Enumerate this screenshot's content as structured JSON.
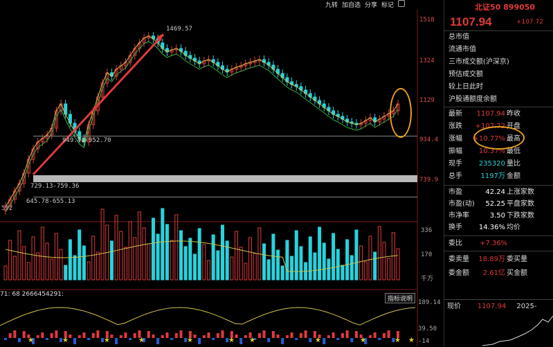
{
  "toolbar": {
    "items": [
      "九转",
      "加自选",
      "分享",
      "标记"
    ]
  },
  "price_axis": [
    "1518",
    "1324",
    "1129",
    "934.4",
    "739.9",
    "592"
  ],
  "volume_axis": [
    "336",
    "170",
    "千万"
  ],
  "indicator_axis": [
    "189.14",
    "39.50",
    "-14"
  ],
  "annotations": {
    "peak": "1469.57",
    "level1": "949.41-952.70",
    "level2": "729.13-759.36",
    "level3": "645.78-655.13"
  },
  "indicator": {
    "text": "71: 68  2666454291:",
    "button": "指标说明"
  },
  "panel": {
    "title": "北证50 899050",
    "price": "1107.94",
    "change": "+107.72",
    "top_labels": [
      "总市值",
      "流通市值",
      "三市成交额(沪深京)",
      "预估成交额",
      "较上日此时",
      "沪股通额度余额"
    ],
    "quote": [
      {
        "v": "1107.94",
        "k": "昨收"
      },
      {
        "v": "+107.72",
        "k": "开盘"
      },
      {
        "v": "+10.77%",
        "k": "最高"
      },
      {
        "v": "10.37%",
        "k": "最低"
      },
      {
        "v": "235320",
        "k": "量比"
      },
      {
        "v": "1197万",
        "k": "金额"
      }
    ],
    "quote_keys": [
      "最新",
      "涨跌",
      "涨幅",
      "振幅",
      "现手",
      "总手"
    ],
    "stats": [
      {
        "k": "市盈",
        "v": "42.24",
        "k2": "上涨家数"
      },
      {
        "k": "市盈(动)",
        "v": "52.25",
        "k2": "平盘家数"
      },
      {
        "k": "市净率",
        "v": "3.50",
        "k2": "下跌家数"
      },
      {
        "k": "换手",
        "v": "14.36%",
        "k2": "均价"
      }
    ],
    "weibi": {
      "k": "委比",
      "v": "+7.36%"
    },
    "bottom": [
      {
        "k": "委卖量",
        "v": "18.89万",
        "k2": "委买量"
      },
      {
        "k": "委金额",
        "v": "2.61亿",
        "k2": "买金额"
      }
    ],
    "mini": {
      "k": "现价",
      "v": "1107.94",
      "date": "2025-"
    }
  }
}
